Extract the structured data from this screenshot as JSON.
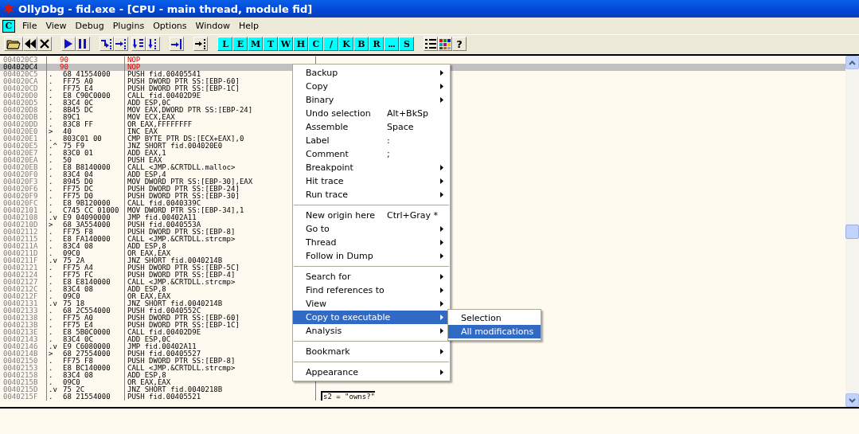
{
  "window": {
    "title": "OllyDbg - fid.exe - [CPU - main thread, module fid]"
  },
  "menu_bar": {
    "child_button": "C",
    "items": [
      "File",
      "View",
      "Debug",
      "Plugins",
      "Options",
      "Window",
      "Help"
    ]
  },
  "toolbar": {
    "letter_buttons": [
      "L",
      "E",
      "M",
      "T",
      "W",
      "H",
      "C",
      "/",
      "K",
      "B",
      "R",
      "...",
      "S"
    ],
    "help_button": "?"
  },
  "disassembly": [
    {
      "address": "004020C3",
      "bytes": "90",
      "instruction": "NOP",
      "modified": true,
      "selected": false
    },
    {
      "address": "004020C4",
      "bytes": "90",
      "instruction": "NOP",
      "modified": true,
      "selected": true
    },
    {
      "address": "004020C5",
      "marker": ".",
      "bytes": "68 41554000",
      "instruction": "PUSH fid.00405541",
      "modified": false,
      "selected": false
    },
    {
      "address": "004020CA",
      "marker": ".",
      "bytes": "FF75 A0",
      "instruction": "PUSH DWORD PTR SS:[EBP-60]",
      "modified": false,
      "selected": false
    },
    {
      "address": "004020CD",
      "marker": ".",
      "bytes": "FF75 E4",
      "instruction": "PUSH DWORD PTR SS:[EBP-1C]",
      "modified": false,
      "selected": false
    },
    {
      "address": "004020D0",
      "marker": ".",
      "bytes": "E8 C90C0000",
      "instruction": "CALL fid.00402D9E",
      "modified": false,
      "selected": false
    },
    {
      "address": "004020D5",
      "marker": ".",
      "bytes": "83C4 0C",
      "instruction": "ADD ESP,0C",
      "modified": false,
      "selected": false
    },
    {
      "address": "004020D8",
      "marker": ".",
      "bytes": "8B45 DC",
      "instruction": "MOV EAX,DWORD PTR SS:[EBP-24]",
      "modified": false,
      "selected": false
    },
    {
      "address": "004020DB",
      "marker": ".",
      "bytes": "89C1",
      "instruction": "MOV ECX,EAX",
      "modified": false,
      "selected": false
    },
    {
      "address": "004020DD",
      "marker": ".",
      "bytes": "83C8 FF",
      "instruction": "OR EAX,FFFFFFFF",
      "modified": false,
      "selected": false
    },
    {
      "address": "004020E0",
      "marker": ">",
      "bytes": "40",
      "instruction": "INC EAX",
      "modified": false,
      "selected": false
    },
    {
      "address": "004020E1",
      "marker": ".",
      "bytes": "803C01 00",
      "instruction": "CMP BYTE PTR DS:[ECX+EAX],0",
      "modified": false,
      "selected": false
    },
    {
      "address": "004020E5",
      "marker": ".^",
      "bytes": "75 F9",
      "instruction": "JNZ SHORT fid.004020E0",
      "modified": false,
      "selected": false
    },
    {
      "address": "004020E7",
      "marker": ".",
      "bytes": "83C0 01",
      "instruction": "ADD EAX,1",
      "modified": false,
      "selected": false
    },
    {
      "address": "004020EA",
      "marker": ".",
      "bytes": "50",
      "instruction": "PUSH EAX",
      "modified": false,
      "selected": false
    },
    {
      "address": "004020EB",
      "marker": ".",
      "bytes": "E8 B8140000",
      "instruction": "CALL <JMP.&CRTDLL.malloc>",
      "modified": false,
      "selected": false
    },
    {
      "address": "004020F0",
      "marker": ".",
      "bytes": "83C4 04",
      "instruction": "ADD ESP,4",
      "modified": false,
      "selected": false
    },
    {
      "address": "004020F3",
      "marker": ".",
      "bytes": "8945 D0",
      "instruction": "MOV DWORD PTR SS:[EBP-30],EAX",
      "modified": false,
      "selected": false
    },
    {
      "address": "004020F6",
      "marker": ".",
      "bytes": "FF75 DC",
      "instruction": "PUSH DWORD PTR SS:[EBP-24]",
      "modified": false,
      "selected": false
    },
    {
      "address": "004020F9",
      "marker": ".",
      "bytes": "FF75 D0",
      "instruction": "PUSH DWORD PTR SS:[EBP-30]",
      "modified": false,
      "selected": false
    },
    {
      "address": "004020FC",
      "marker": ".",
      "bytes": "E8 9B120000",
      "instruction": "CALL fid.0040339C",
      "modified": false,
      "selected": false
    },
    {
      "address": "00402101",
      "marker": ".",
      "bytes": "C745 CC 01000",
      "instruction": "MOV DWORD PTR SS:[EBP-34],1",
      "modified": false,
      "selected": false
    },
    {
      "address": "00402108",
      "marker": ".v",
      "bytes": "E9 04090000",
      "instruction": "JMP fid.00402A11",
      "modified": false,
      "selected": false
    },
    {
      "address": "0040210D",
      "marker": ">",
      "bytes": "68 3A554000",
      "instruction": "PUSH fid.0040553A",
      "modified": false,
      "selected": false
    },
    {
      "address": "00402112",
      "marker": ".",
      "bytes": "FF75 F8",
      "instruction": "PUSH DWORD PTR SS:[EBP-8]",
      "modified": false,
      "selected": false
    },
    {
      "address": "00402115",
      "marker": ".",
      "bytes": "E8 FA140000",
      "instruction": "CALL <JMP.&CRTDLL.strcmp>",
      "modified": false,
      "selected": false
    },
    {
      "address": "0040211A",
      "marker": ".",
      "bytes": "83C4 08",
      "instruction": "ADD ESP,8",
      "modified": false,
      "selected": false
    },
    {
      "address": "0040211D",
      "marker": ".",
      "bytes": "09C0",
      "instruction": "OR EAX,EAX",
      "modified": false,
      "selected": false
    },
    {
      "address": "0040211F",
      "marker": ".v",
      "bytes": "75 2A",
      "instruction": "JNZ SHORT fid.0040214B",
      "modified": false,
      "selected": false
    },
    {
      "address": "00402121",
      "marker": ".",
      "bytes": "FF75 A4",
      "instruction": "PUSH DWORD PTR SS:[EBP-5C]",
      "modified": false,
      "selected": false
    },
    {
      "address": "00402124",
      "marker": ".",
      "bytes": "FF75 FC",
      "instruction": "PUSH DWORD PTR SS:[EBP-4]",
      "modified": false,
      "selected": false
    },
    {
      "address": "00402127",
      "marker": ".",
      "bytes": "E8 E8140000",
      "instruction": "CALL <JMP.&CRTDLL.strcmp>",
      "modified": false,
      "selected": false
    },
    {
      "address": "0040212C",
      "marker": ".",
      "bytes": "83C4 08",
      "instruction": "ADD ESP,8",
      "modified": false,
      "selected": false
    },
    {
      "address": "0040212F",
      "marker": ".",
      "bytes": "09C0",
      "instruction": "OR EAX,EAX",
      "modified": false,
      "selected": false
    },
    {
      "address": "00402131",
      "marker": ".v",
      "bytes": "75 18",
      "instruction": "JNZ SHORT fid.0040214B",
      "modified": false,
      "selected": false
    },
    {
      "address": "00402133",
      "marker": ".",
      "bytes": "68 2C554000",
      "instruction": "PUSH fid.0040552C",
      "modified": false,
      "selected": false
    },
    {
      "address": "00402138",
      "marker": ".",
      "bytes": "FF75 A0",
      "instruction": "PUSH DWORD PTR SS:[EBP-60]",
      "modified": false,
      "selected": false
    },
    {
      "address": "0040213B",
      "marker": ".",
      "bytes": "FF75 E4",
      "instruction": "PUSH DWORD PTR SS:[EBP-1C]",
      "modified": false,
      "selected": false
    },
    {
      "address": "0040213E",
      "marker": ".",
      "bytes": "E8 5B0C0000",
      "instruction": "CALL fid.00402D9E",
      "modified": false,
      "selected": false
    },
    {
      "address": "00402143",
      "marker": ".",
      "bytes": "83C4 0C",
      "instruction": "ADD ESP,0C",
      "modified": false,
      "selected": false
    },
    {
      "address": "00402146",
      "marker": ".v",
      "bytes": "E9 C6080000",
      "instruction": "JMP fid.00402A11",
      "modified": false,
      "selected": false
    },
    {
      "address": "0040214B",
      "marker": ">",
      "bytes": "68 27554000",
      "instruction": "PUSH fid.00405527",
      "modified": false,
      "selected": false
    },
    {
      "address": "00402150",
      "marker": ".",
      "bytes": "FF75 F8",
      "instruction": "PUSH DWORD PTR SS:[EBP-8]",
      "modified": false,
      "selected": false
    },
    {
      "address": "00402153",
      "marker": ".",
      "bytes": "E8 BC140000",
      "instruction": "CALL <JMP.&CRTDLL.strcmp>",
      "modified": false,
      "selected": false
    },
    {
      "address": "00402158",
      "marker": ".",
      "bytes": "83C4 08",
      "instruction": "ADD ESP,8",
      "modified": false,
      "selected": false
    },
    {
      "address": "0040215B",
      "marker": ".",
      "bytes": "09C0",
      "instruction": "OR EAX,EAX",
      "modified": false,
      "selected": false
    },
    {
      "address": "0040215D",
      "marker": ".v",
      "bytes": "75 2C",
      "instruction": "JNZ SHORT fid.0040218B",
      "modified": false,
      "selected": false
    },
    {
      "address": "0040215F",
      "marker": ".",
      "bytes": "68 21554000",
      "instruction": "PUSH fid.00405521",
      "comment": "s2 = \"owns?\"",
      "modified": false,
      "selected": false
    }
  ],
  "context_menu": [
    {
      "kind": "item",
      "label": "Backup",
      "submenu": true,
      "selected": false
    },
    {
      "kind": "item",
      "label": "Copy",
      "submenu": true,
      "selected": false
    },
    {
      "kind": "item",
      "label": "Binary",
      "submenu": true,
      "selected": false
    },
    {
      "kind": "item",
      "label": "Undo selection",
      "shortcut": "Alt+BkSp",
      "submenu": false,
      "selected": false
    },
    {
      "kind": "item",
      "label": "Assemble",
      "shortcut": "Space",
      "submenu": false,
      "selected": false
    },
    {
      "kind": "item",
      "label": "Label",
      "shortcut": ":",
      "submenu": false,
      "selected": false
    },
    {
      "kind": "item",
      "label": "Comment",
      "shortcut": ";",
      "submenu": false,
      "selected": false
    },
    {
      "kind": "item",
      "label": "Breakpoint",
      "submenu": true,
      "selected": false
    },
    {
      "kind": "item",
      "label": "Hit trace",
      "submenu": true,
      "selected": false
    },
    {
      "kind": "item",
      "label": "Run trace",
      "submenu": true,
      "selected": false
    },
    {
      "kind": "separator"
    },
    {
      "kind": "item",
      "label": "New origin here",
      "shortcut": "Ctrl+Gray *",
      "submenu": false,
      "selected": false
    },
    {
      "kind": "item",
      "label": "Go to",
      "submenu": true,
      "selected": false
    },
    {
      "kind": "item",
      "label": "Thread",
      "submenu": true,
      "selected": false
    },
    {
      "kind": "item",
      "label": "Follow in Dump",
      "submenu": true,
      "selected": false
    },
    {
      "kind": "separator"
    },
    {
      "kind": "item",
      "label": "Search for",
      "submenu": true,
      "selected": false
    },
    {
      "kind": "item",
      "label": "Find references to",
      "submenu": true,
      "selected": false
    },
    {
      "kind": "item",
      "label": "View",
      "submenu": true,
      "selected": false
    },
    {
      "kind": "item",
      "label": "Copy to executable",
      "submenu": true,
      "selected": true
    },
    {
      "kind": "item",
      "label": "Analysis",
      "submenu": true,
      "selected": false
    },
    {
      "kind": "separator"
    },
    {
      "kind": "item",
      "label": "Bookmark",
      "submenu": true,
      "selected": false
    },
    {
      "kind": "separator"
    },
    {
      "kind": "item",
      "label": "Appearance",
      "submenu": true,
      "selected": false
    }
  ],
  "submenu": [
    {
      "label": "Selection",
      "selected": false
    },
    {
      "label": "All modifications",
      "selected": true
    }
  ]
}
